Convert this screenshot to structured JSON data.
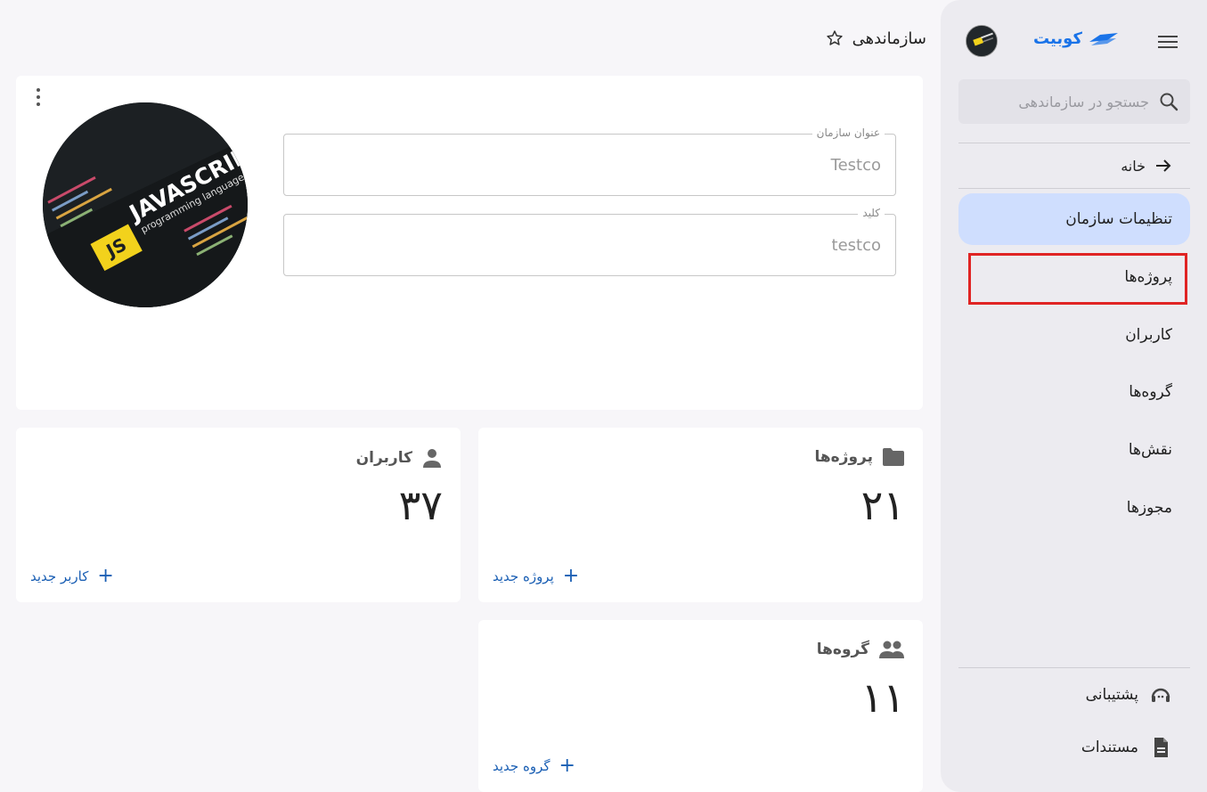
{
  "header": {
    "title": "سازماندهی"
  },
  "sidebar": {
    "brand_name": "کوبیت",
    "search_placeholder": "جستجو در سازماندهی",
    "home_label": "خانه",
    "items": [
      {
        "label": "تنظیمات سازمان",
        "active": true
      },
      {
        "label": "پروژه‌ها",
        "highlighted": true
      },
      {
        "label": "کاربران"
      },
      {
        "label": "گروه‌ها"
      },
      {
        "label": "نقش‌ها"
      },
      {
        "label": "مجوزها"
      }
    ],
    "bottom": [
      {
        "label": "پشتیبانی",
        "icon": "support-icon"
      },
      {
        "label": "مستندات",
        "icon": "document-icon"
      }
    ]
  },
  "org": {
    "title_label": "عنوان سازمان",
    "title_value": "Testco",
    "key_label": "کلید",
    "key_value": "testco",
    "avatar_text": {
      "main": "JAVASCRIPT",
      "sub": "programming language",
      "badge": "JS"
    }
  },
  "stats": {
    "projects": {
      "title": "پروژه‌ها",
      "count": "۲۱",
      "add_label": "پروژه جدید",
      "icon": "folder-icon"
    },
    "users": {
      "title": "کاربران",
      "count": "۳۷",
      "add_label": "کاربر جدید",
      "icon": "person-icon"
    },
    "groups": {
      "title": "گروه‌ها",
      "count": "۱۱",
      "add_label": "گروه جدید",
      "icon": "group-icon"
    }
  },
  "colors": {
    "accent": "#1a73e8",
    "active_bg": "#cfdefe",
    "highlight": "#e02424"
  }
}
